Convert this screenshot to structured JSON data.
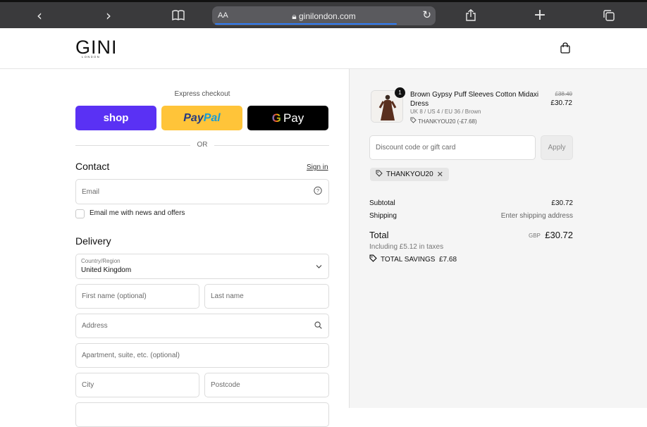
{
  "browser": {
    "text_size_label": "AA",
    "url": "ginilondon.com"
  },
  "brand": {
    "name": "GINI",
    "sub": "LONDON"
  },
  "express": {
    "label": "Express checkout",
    "shop_label": "shop",
    "paypal_a": "Pay",
    "paypal_b": "Pal",
    "gpay_g": "G",
    "gpay_label": "Pay",
    "or_label": "OR"
  },
  "contact": {
    "heading": "Contact",
    "signin": "Sign in",
    "email_placeholder": "Email",
    "newsletter_label": "Email me with news and offers"
  },
  "delivery": {
    "heading": "Delivery",
    "country_label": "Country/Region",
    "country_value": "United Kingdom",
    "first_name": "First name (optional)",
    "last_name": "Last name",
    "address": "Address",
    "apartment": "Apartment, suite, etc. (optional)",
    "city": "City",
    "postcode": "Postcode"
  },
  "order": {
    "item": {
      "quantity": "1",
      "title": "Brown Gypsy Puff Sleeves Cotton Midaxi Dress",
      "variant": "UK 8 / US 4 / EU 36 / Brown",
      "code": "THANKYOU20 (-£7.68)",
      "old_price": "£38.40",
      "price": "£30.72"
    },
    "discount_placeholder": "Discount code or gift card",
    "apply_label": "Apply",
    "applied_code": "THANKYOU20",
    "subtotal_label": "Subtotal",
    "subtotal_value": "£30.72",
    "shipping_label": "Shipping",
    "shipping_value": "Enter shipping address",
    "total_label": "Total",
    "currency": "GBP",
    "total_value": "£30.72",
    "taxes": "Including £5.12 in taxes",
    "savings": "TOTAL SAVINGS  £7.68"
  },
  "colors": {
    "shop": "#5a31f4",
    "paypal": "#ffc439",
    "gpay": "#000000",
    "browser_chrome": "#3a3a3c",
    "summary_bg": "#f5f5f5"
  },
  "icons": [
    "back-icon",
    "forward-icon",
    "book-icon",
    "lock-icon",
    "reload-icon",
    "share-icon",
    "plus-icon",
    "tabs-icon",
    "bag-icon",
    "help-icon",
    "chevron-down-icon",
    "search-icon",
    "tag-icon",
    "close-icon",
    "savings-tag-icon"
  ]
}
